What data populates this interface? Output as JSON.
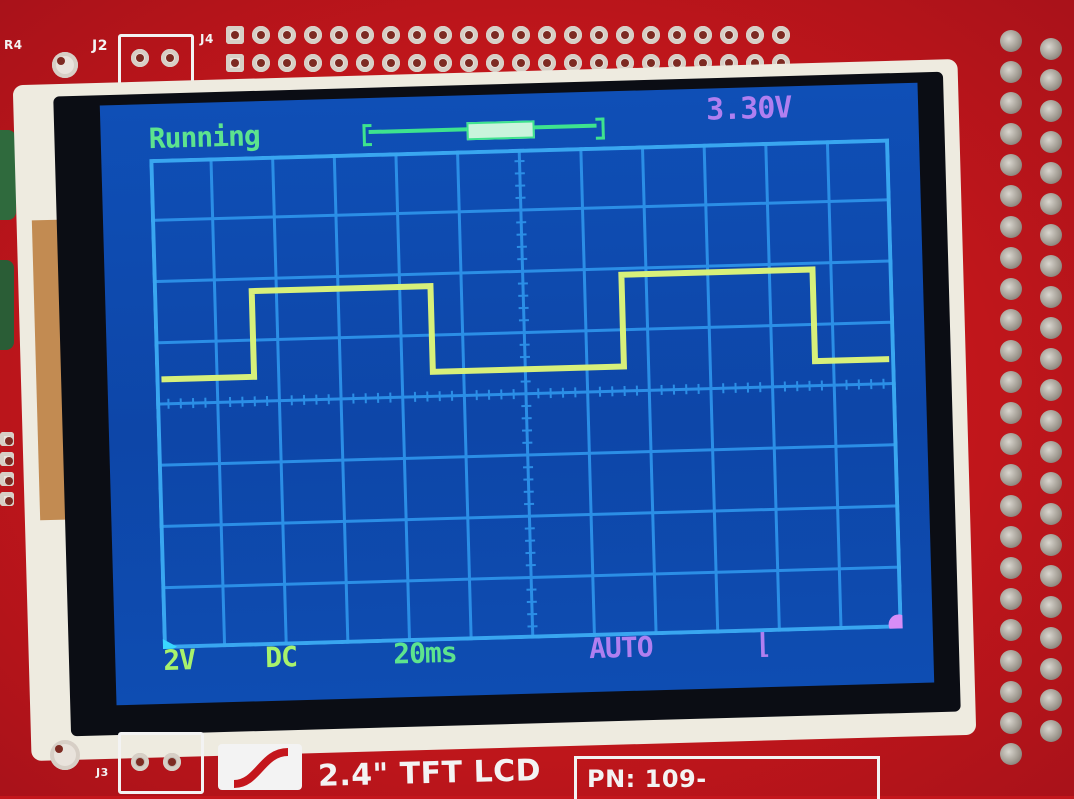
{
  "board": {
    "silkscreen_top": [
      "J2",
      "J4",
      "R4"
    ],
    "silkscreen_bottom": [
      "J3",
      "2.4\" TFT LCD",
      "PN: 109-"
    ]
  },
  "scope": {
    "status": "Running",
    "voltage_readout": "3.30V",
    "volts_per_div": "2V",
    "coupling": "DC",
    "timebase": "20ms",
    "trigger_mode": "AUTO",
    "trigger_slope": "⌊",
    "colors": {
      "screen": "#0d48ad",
      "grid": "#2b8ee6",
      "frame": "#39a6f0",
      "trace": "#d7f07a",
      "status_text": "#5de38e",
      "info_text": "#b07ff0"
    }
  }
}
